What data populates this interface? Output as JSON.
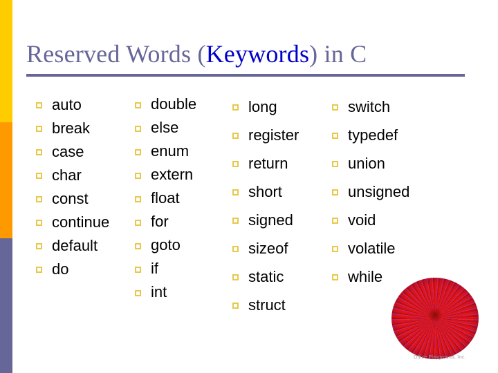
{
  "slide": {
    "title_prefix": "Reserved Words (",
    "title_keyword": "Keywords",
    "title_suffix": ") in C",
    "title_full": "Reserved Words (Keywords) in C"
  },
  "theme": {
    "title_color": "#666699",
    "keyword_highlight_color": "#0000CC",
    "rule_color": "#666699",
    "bullet_color": "#E8C84A",
    "sidebar_yellow": "#FFCC00",
    "sidebar_orange": "#FF9900",
    "sidebar_slate": "#666699",
    "body_text_color": "#000000",
    "background": "#FFFFFF"
  },
  "keyword_columns": [
    {
      "index": 0,
      "items": [
        "auto",
        "break",
        "case",
        "char",
        "const",
        "continue",
        "default",
        "do"
      ]
    },
    {
      "index": 1,
      "items": [
        "double",
        "else",
        "enum",
        "extern",
        "float",
        "for",
        "goto",
        "if",
        "int"
      ]
    },
    {
      "index": 2,
      "items": [
        "long",
        "register",
        "return",
        "short",
        "signed",
        "sizeof",
        "static",
        "struct"
      ]
    },
    {
      "index": 3,
      "items": [
        "switch",
        "typedef",
        "union",
        "unsigned",
        "void",
        "volatile",
        "while"
      ]
    }
  ],
  "decoration": {
    "image_name": "pom-pom-ball",
    "watermark": "Office Playground, Inc."
  }
}
